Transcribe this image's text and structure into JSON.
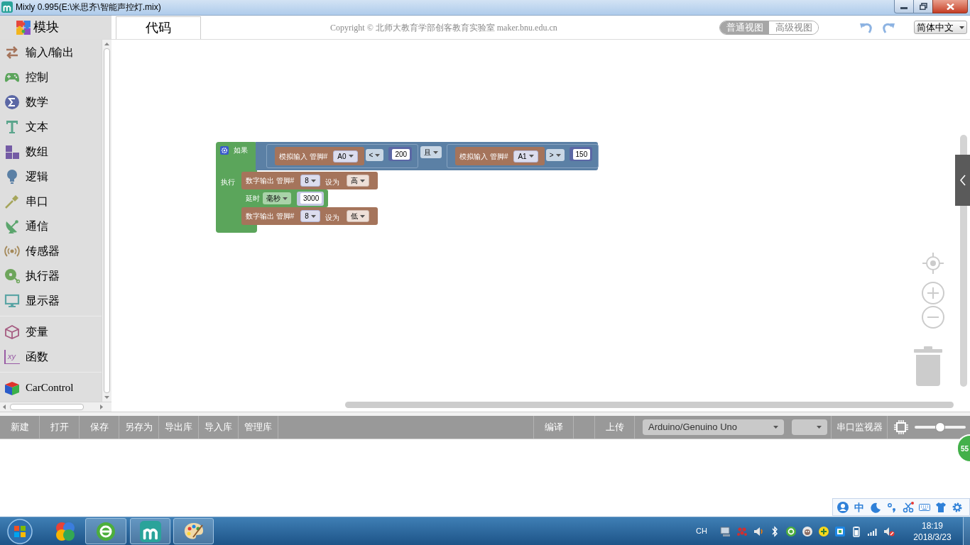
{
  "window": {
    "title": "Mixly 0.995(E:\\米思齐\\智能声控灯.mix)"
  },
  "tabs": [
    {
      "label": "模块",
      "selected": true
    },
    {
      "label": "代码",
      "selected": false
    }
  ],
  "header": {
    "copyright": "Copyright © 北师大教育学部创客教育实验室 maker.bnu.edu.cn",
    "view_modes": [
      {
        "label": "普通视图",
        "selected": true
      },
      {
        "label": "高级视图",
        "selected": false
      }
    ],
    "language": "简体中文"
  },
  "sidebar": {
    "sections": [
      {
        "items": [
          {
            "label": "输入/输出"
          },
          {
            "label": "控制"
          },
          {
            "label": "数学"
          },
          {
            "label": "文本"
          },
          {
            "label": "数组"
          },
          {
            "label": "逻辑"
          },
          {
            "label": "串口"
          },
          {
            "label": "通信"
          },
          {
            "label": "传感器"
          },
          {
            "label": "执行器"
          },
          {
            "label": "显示器"
          }
        ]
      },
      {
        "items": [
          {
            "label": "变量"
          },
          {
            "label": "函数",
            "icon_text": "xy"
          }
        ]
      },
      {
        "items": [
          {
            "label": "CarControl"
          }
        ]
      }
    ]
  },
  "workspace": {
    "if_block": {
      "label": "如果",
      "do_label": "执行",
      "condition": {
        "joiner": "且",
        "comparisons": [
          {
            "sensor_label": "模拟输入 管脚#",
            "pin": "A0",
            "operator": "<",
            "number": "200"
          },
          {
            "sensor_label": "模拟输入 管脚#",
            "pin": "A1",
            "operator": ">",
            "number": "150"
          }
        ]
      },
      "statements": [
        {
          "kind": "digital_write",
          "label": "数字输出 管脚#",
          "pin": "8",
          "set_label": "设为",
          "output": "高"
        },
        {
          "kind": "delay",
          "label": "延时",
          "unit": "毫秒",
          "number": "3000"
        },
        {
          "kind": "digital_write",
          "label": "数字输出 管脚#",
          "pin": "8",
          "set_label": "设为",
          "output": "低"
        }
      ]
    }
  },
  "toolbar": {
    "file_buttons": [
      "新建",
      "打开",
      "保存",
      "另存为",
      "导出库",
      "导入库",
      "管理库"
    ],
    "compile": "编译",
    "upload": "上传",
    "board": "Arduino/Genuino Uno",
    "serial_monitor": "串口监视器",
    "zoom_slider": {
      "level": 0.5
    }
  },
  "status_badge": "55",
  "ime": {
    "mode": "中"
  },
  "taskbar": {
    "language": "CH",
    "time": "18:19",
    "date": "2018/3/23"
  }
}
